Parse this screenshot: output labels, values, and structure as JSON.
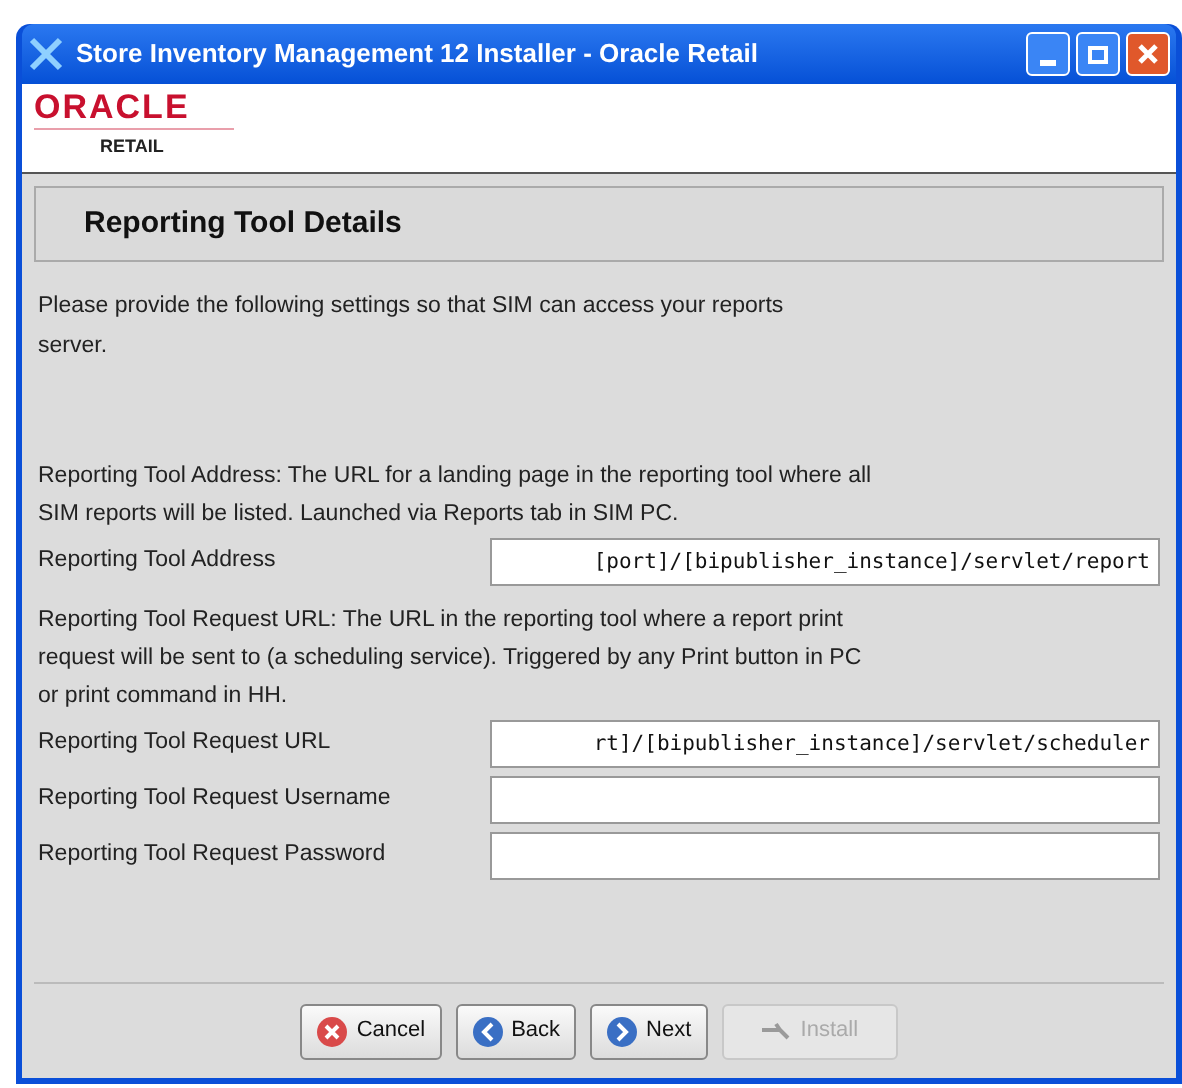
{
  "window": {
    "title": "Store Inventory Management 12 Installer - Oracle Retail"
  },
  "logo": {
    "brand": "ORACLE",
    "sub": "RETAIL"
  },
  "header": {
    "title": "Reporting Tool Details"
  },
  "intro": "Please provide the following settings so that SIM can access your reports server.",
  "sections": [
    {
      "description": "Reporting Tool Address:  The URL for a landing page in the reporting tool where all SIM reports will be listed. Launched via Reports tab in SIM PC.",
      "fields": [
        {
          "label": "Reporting Tool Address",
          "value": "[port]/[bipublisher_instance]/servlet/report"
        }
      ]
    },
    {
      "description": "Reporting Tool Request URL:  The URL in the reporting tool where a report print request will be sent to (a scheduling service). Triggered by any Print button in PC or print command in HH.",
      "fields": [
        {
          "label": "Reporting Tool Request URL",
          "value": "rt]/[bipublisher_instance]/servlet/scheduler"
        },
        {
          "label": "Reporting Tool Request Username"
        },
        {
          "label": "Reporting Tool Request Password"
        }
      ]
    }
  ],
  "buttons": [
    {
      "label": "Cancel",
      "kind": "cancel",
      "disabled": false
    },
    {
      "label": "Back",
      "kind": "back",
      "disabled": false
    },
    {
      "label": "Next",
      "kind": "next",
      "disabled": false
    },
    {
      "label": "Install",
      "kind": "install",
      "disabled": true
    }
  ]
}
